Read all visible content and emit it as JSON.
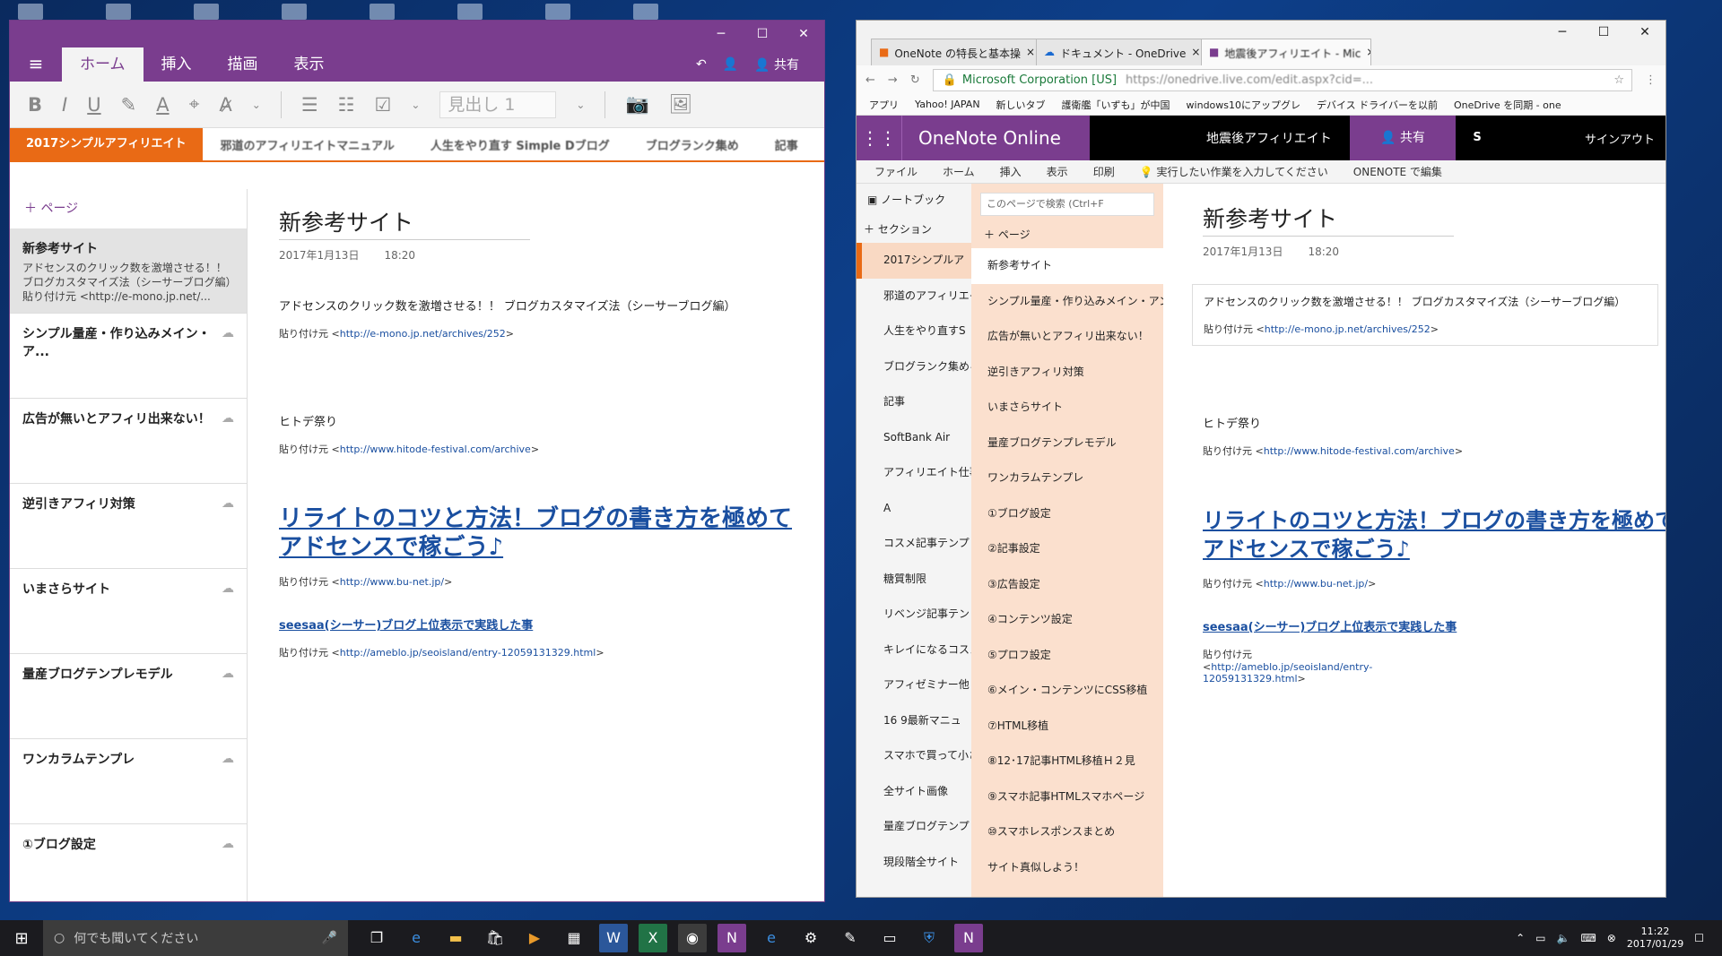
{
  "left_window": {
    "ribbon_tabs": [
      "ホーム",
      "挿入",
      "描画",
      "表示"
    ],
    "share_label": "共有",
    "style_box": "見出し 1",
    "active_section": "2017シンプルアフィリエイト",
    "other_sections": [
      "邪道のアフィリエイトマニュアル",
      "人生をやり直す Simple Dブログ",
      "ブログランク集め",
      "記事"
    ],
    "add_page": "ページ",
    "pages": [
      {
        "title": "新参考サイト",
        "preview": "アドセンスのクリック数を激増させる！！ ブログカスタマイズ法（シーサーブログ編）",
        "preview2": "貼り付け元 <http://e-mono.jp.net/..."
      },
      {
        "title": "シンプル量産・作り込みメイン・ア..."
      },
      {
        "title": "広告が無いとアフィリ出来ない！"
      },
      {
        "title": "逆引きアフィリ対策"
      },
      {
        "title": "いまさらサイト"
      },
      {
        "title": "量産ブログテンプレモデル"
      },
      {
        "title": "ワンカラムテンプレ"
      },
      {
        "title": "①ブログ設定"
      }
    ],
    "page": {
      "title": "新参考サイト",
      "date": "2017年1月13日",
      "time": "18:20",
      "line1": "アドセンスのクリック数を激増させる！！ ブログカスタマイズ法（シーサーブログ編）",
      "pasted_label": "貼り付け元",
      "url1": "http://e-mono.jp.net/archives/252",
      "line2": "ヒトデ祭り",
      "url2": "http://www.hitode-festival.com/archive",
      "heading1": "リライトのコツと方法！ブログの書き方を極めて",
      "heading1b": "アドセンスで稼ごう♪",
      "url3": "http://www.bu-net.jp/",
      "heading2": "seesaa(シーサー)ブログ上位表示で実践した事",
      "url4": "http://ameblo.jp/seoisland/entry-12059131329.html"
    }
  },
  "right_window": {
    "tabs": [
      "OneNote の特長と基本操",
      "ドキュメント - OneDrive",
      "地震後アフィリエイト - Mic"
    ],
    "address_secure": "Microsoft Corporation [US]",
    "bookmarks": [
      "アプリ",
      "Yahoo! JAPAN",
      "新しいタブ",
      "護衛艦「いずも」が中国",
      "windows10にアップグレ",
      "デバイス ドライバーを以前",
      "OneDrive を同期 - one"
    ],
    "app_name": "OneNote Online",
    "notebook_name": "地震後アフィリエイト",
    "share_label": "共有",
    "skype": "S",
    "signout": "サインアウト",
    "menu": [
      "ファイル",
      "ホーム",
      "挿入",
      "表示",
      "印刷",
      "実行したい作業を入力してください",
      "ONENOTE で編集"
    ],
    "notebook_label": "ノートブック",
    "section_label": "セクション",
    "page_label": "ページ",
    "search_placeholder": "このページで検索 (Ctrl+F",
    "sections": [
      "2017シンプルア",
      "邪道のアフィリエイ",
      "人生をやり直すS",
      "ブログランク集めるき",
      "記事",
      "SoftBank Air",
      "アフィリエイト仕事",
      "A",
      "コスメ記事テンプレ",
      "糖質制限",
      "リベンジ記事テン",
      "キレイになるコスメ",
      "アフィゼミナー他",
      "16 9最新マニュ",
      "スマホで買って小さ",
      "全サイト画像",
      "量産ブログテンプ",
      "現段階全サイト"
    ],
    "pages": [
      "新参考サイト",
      "シンプル量産・作り込みメイン・アン",
      "広告が無いとアフィリ出来ない！",
      "逆引きアフィリ対策",
      "いまさらサイト",
      "量産ブログテンプレモデル",
      "ワンカラムテンプレ",
      "①ブログ設定",
      "②記事設定",
      "③広告設定",
      "④コンテンツ設定",
      "⑤プロフ設定",
      "⑥メイン・コンテンツにCSS移植",
      "⑦HTML移植",
      "⑧12･17記事HTML移植Ｈ２見",
      "⑨スマホ記事HTMLスマホページ",
      "⑩スマホレスポンスまとめ",
      "サイト真似しよう！"
    ]
  },
  "taskbar": {
    "search_placeholder": "何でも聞いてください",
    "time": "11:22",
    "date": "2017/01/29"
  }
}
